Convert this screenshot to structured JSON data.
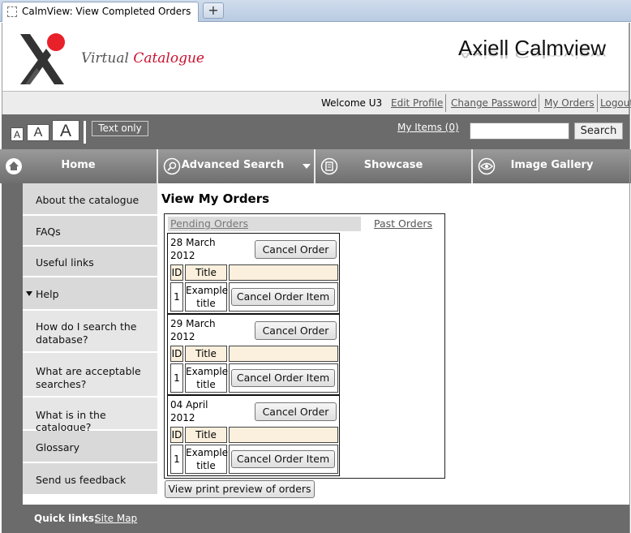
{
  "browser": {
    "tab_title": "CalmView: View Completed Orders",
    "new_tab_label": "+"
  },
  "header": {
    "logo_word1": "Virtual",
    "logo_word2": "Catalogue",
    "brand": "Axiell Calmview"
  },
  "userbar": {
    "welcome": "Welcome U3",
    "links": [
      "Edit Profile",
      "Change Password",
      "My Orders",
      "Logout"
    ]
  },
  "toolbar": {
    "font_sizes": [
      "A",
      "A",
      "A"
    ],
    "text_only": "Text only",
    "my_items": "My Items (0)",
    "search_value": "",
    "search_button": "Search"
  },
  "nav": {
    "tabs": [
      {
        "label": "Home",
        "icon": "home-icon"
      },
      {
        "label": "Advanced Search",
        "icon": "search-icon"
      },
      {
        "label": "Showcase",
        "icon": "showcase-icon"
      },
      {
        "label": "Image Gallery",
        "icon": "eye-icon"
      }
    ]
  },
  "sidebar": {
    "items": [
      "About the catalogue",
      "FAQs",
      "Useful links",
      "Help",
      "How do I search the database?",
      "What are acceptable searches?",
      "What is in the catalogue?",
      "Glossary",
      "Send us feedback"
    ]
  },
  "main": {
    "title": "View My Orders",
    "tab_pending": "Pending Orders",
    "tab_past": "Past Orders",
    "col_id": "ID",
    "col_title": "Title",
    "cancel_order": "Cancel Order",
    "cancel_item": "Cancel Order Item",
    "orders": [
      {
        "date_line1": "28 March",
        "date_line2": "2012",
        "item_id": "1",
        "item_title_1": "Example",
        "item_title_2": "title"
      },
      {
        "date_line1": "29 March",
        "date_line2": "2012",
        "item_id": "1",
        "item_title_1": "Example",
        "item_title_2": "title"
      },
      {
        "date_line1": "04 April",
        "date_line2": "2012",
        "item_id": "1",
        "item_title_1": "Example",
        "item_title_2": "title"
      }
    ],
    "print_preview": "View print preview of orders"
  },
  "footer": {
    "quick_links": "Quick links:",
    "site_map": "Site Map"
  },
  "colors": {
    "dark_bar": "#6b6b6b",
    "logo_red": "#e8202a",
    "table_header": "#fbf0dd"
  }
}
